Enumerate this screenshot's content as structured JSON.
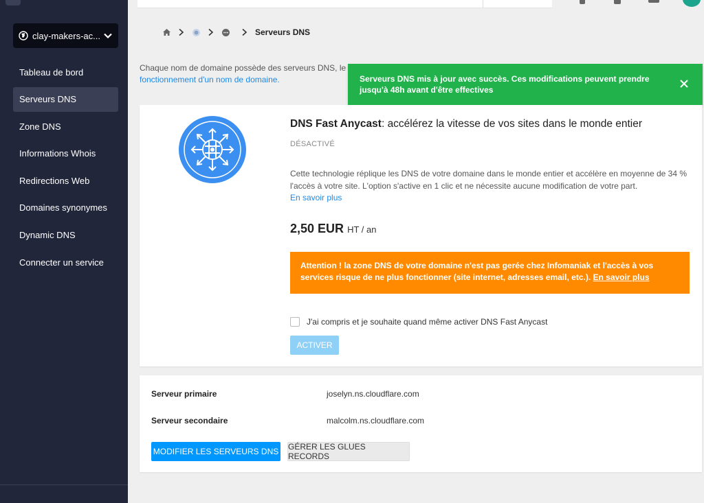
{
  "sidebar": {
    "domain": "clay-makers-ac...",
    "items": [
      {
        "label": "Tableau de bord",
        "active": false
      },
      {
        "label": "Serveurs DNS",
        "active": true
      },
      {
        "label": "Zone DNS",
        "active": false
      },
      {
        "label": "Informations Whois",
        "active": false
      },
      {
        "label": "Redirections Web",
        "active": false
      },
      {
        "label": "Domaines synonymes",
        "active": false
      },
      {
        "label": "Dynamic DNS",
        "active": false
      },
      {
        "label": "Connecter un service",
        "active": false
      }
    ]
  },
  "breadcrumb": {
    "icons": [
      "home-icon",
      "globe-icon",
      "dots-icon"
    ],
    "current": "Serveurs DNS"
  },
  "intro": {
    "text": "Chaque nom de domaine possède des serveurs DNS, lesq",
    "link": "fonctionnement d'un nom de domaine."
  },
  "toast": {
    "message": "Serveurs DNS mis à jour avec succès. Ces modifications peuvent prendre jusqu'à 48h avant d'être effectives",
    "color": "#21b24b"
  },
  "anycast": {
    "title_bold": "DNS Fast Anycast",
    "title_rest": ": accélérez la vitesse de vos sites dans le monde entier",
    "status": "DÉSACTIVÉ",
    "description": "Cette technologie réplique les DNS de votre domaine dans le monde entier et accélère en moyenne de 34 % l'accès à votre site. L'option s'active en 1 clic et ne nécessite aucune modification de votre part.",
    "more_link": "En savoir plus",
    "price": "2,50 EUR",
    "price_unit": "HT / an",
    "warning": "Attention ! la zone DNS de votre domaine n'est pas gerée chez Infomaniak et l'accès à vos services risque de ne plus fonctionner (site internet, adresses email, etc.). ",
    "warning_link": "En savoir plus",
    "checkbox_label": "J'ai compris et je souhaite quand même activer DNS Fast Anycast",
    "activate_button": "ACTIVER"
  },
  "servers": {
    "primary_label": "Serveur primaire",
    "primary_value": "joselyn.ns.cloudflare.com",
    "secondary_label": "Serveur secondaire",
    "secondary_value": "malcolm.ns.cloudflare.com",
    "modify_button": "MODIFIER LES SERVEURS DNS",
    "glue_button": "GÉRER LES GLUES RECORDS"
  },
  "colors": {
    "sidebar": "#21263a",
    "accent": "#0098ff",
    "warning": "#ff8a00",
    "success": "#21b24b"
  }
}
